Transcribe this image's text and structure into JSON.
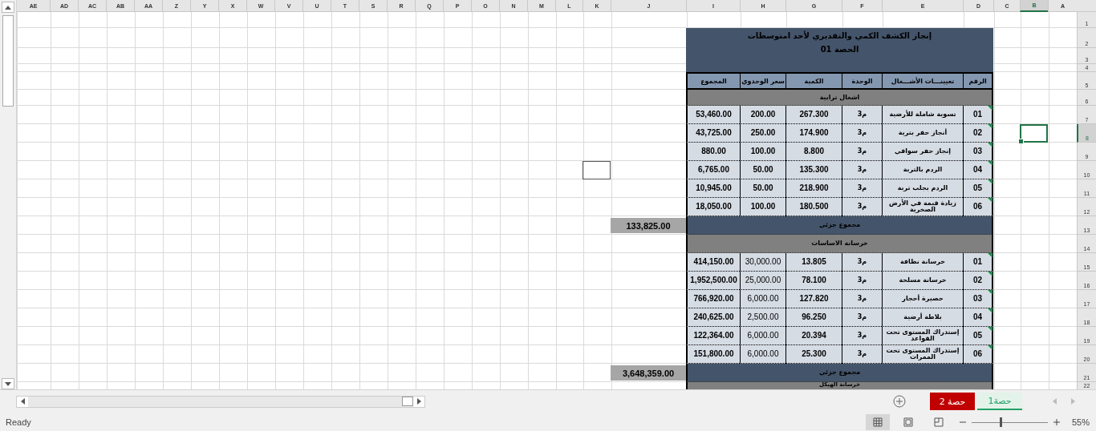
{
  "columns": [
    {
      "label": "A",
      "selected": false
    },
    {
      "label": "B",
      "selected": true
    },
    {
      "label": "C",
      "selected": false
    },
    {
      "label": "D",
      "selected": false
    },
    {
      "label": "E",
      "selected": false
    },
    {
      "label": "F",
      "selected": false
    },
    {
      "label": "G",
      "selected": false
    },
    {
      "label": "H",
      "selected": false
    },
    {
      "label": "I",
      "selected": false
    },
    {
      "label": "J",
      "selected": false
    },
    {
      "label": "K",
      "selected": false
    },
    {
      "label": "L",
      "selected": false
    },
    {
      "label": "M",
      "selected": false
    },
    {
      "label": "N",
      "selected": false
    },
    {
      "label": "O",
      "selected": false
    },
    {
      "label": "P",
      "selected": false
    },
    {
      "label": "Q",
      "selected": false
    },
    {
      "label": "R",
      "selected": false
    },
    {
      "label": "S",
      "selected": false
    },
    {
      "label": "T",
      "selected": false
    },
    {
      "label": "U",
      "selected": false
    },
    {
      "label": "V",
      "selected": false
    },
    {
      "label": "W",
      "selected": false
    },
    {
      "label": "X",
      "selected": false
    },
    {
      "label": "Y",
      "selected": false
    },
    {
      "label": "Z",
      "selected": false
    },
    {
      "label": "AA",
      "selected": false
    },
    {
      "label": "AB",
      "selected": false
    },
    {
      "label": "AC",
      "selected": false
    },
    {
      "label": "AD",
      "selected": false
    },
    {
      "label": "AE",
      "selected": false
    }
  ],
  "rows": [
    {
      "label": "1",
      "selected": false
    },
    {
      "label": "2",
      "selected": false
    },
    {
      "label": "3",
      "selected": false
    },
    {
      "label": "4",
      "selected": false
    },
    {
      "label": "5",
      "selected": false
    },
    {
      "label": "6",
      "selected": false
    },
    {
      "label": "7",
      "selected": false
    },
    {
      "label": "8",
      "selected": true
    },
    {
      "label": "9",
      "selected": false
    },
    {
      "label": "10",
      "selected": false
    },
    {
      "label": "11",
      "selected": false
    },
    {
      "label": "12",
      "selected": false
    },
    {
      "label": "13",
      "selected": false
    },
    {
      "label": "14",
      "selected": false
    },
    {
      "label": "15",
      "selected": false
    },
    {
      "label": "16",
      "selected": false
    },
    {
      "label": "17",
      "selected": false
    },
    {
      "label": "18",
      "selected": false
    },
    {
      "label": "19",
      "selected": false
    },
    {
      "label": "20",
      "selected": false
    },
    {
      "label": "21",
      "selected": false
    },
    {
      "label": "22",
      "selected": false
    }
  ],
  "table": {
    "title": "إنجاز الكشف الكمي والتقديري لأحد امتوسطات",
    "subtitle": "الحصة 01",
    "headers": [
      "الرقم",
      "تعيينـــات الأشـــغال",
      "الوحدة",
      "الكمية",
      "سعر الوحدوي",
      "المجموع"
    ],
    "sections": [
      {
        "name": "اشغال ترابية",
        "bold_prices": true,
        "subtotal_label": "مجموع جزئي",
        "subtotal": "133,825.00",
        "items": [
          {
            "number": "01",
            "description": "تسوية شاملة للأرضية",
            "unit": "م3",
            "quantity": "267.300",
            "unit_price": "200.00",
            "total": "53,460.00"
          },
          {
            "number": "02",
            "description": "أنجاز حفر بترية",
            "unit": "م3",
            "quantity": "174.900",
            "unit_price": "250.00",
            "total": "43,725.00"
          },
          {
            "number": "03",
            "description": "إنجاز حفر سواقي",
            "unit": "م3",
            "quantity": "8.800",
            "unit_price": "100.00",
            "total": "880.00"
          },
          {
            "number": "04",
            "description": "الردم بالتربة",
            "unit": "م3",
            "quantity": "135.300",
            "unit_price": "50.00",
            "total": "6,765.00"
          },
          {
            "number": "05",
            "description": "الردم بجلب تربة",
            "unit": "م3",
            "quantity": "218.900",
            "unit_price": "50.00",
            "total": "10,945.00"
          },
          {
            "number": "06",
            "description": "زيادة قيمة في الأرض الصخرية",
            "unit": "م3",
            "quantity": "180.500",
            "unit_price": "100.00",
            "total": "18,050.00"
          }
        ]
      },
      {
        "name": "خرسانة الاساسات",
        "bold_prices": false,
        "subtotal_label": "مجموع جزئي",
        "subtotal": "3,648,359.00",
        "items": [
          {
            "number": "01",
            "description": "خرسانة نظافة",
            "unit": "م3",
            "quantity": "13.805",
            "unit_price": "30,000.00",
            "total": "414,150.00"
          },
          {
            "number": "02",
            "description": "خرسانة مسلحة",
            "unit": "م3",
            "quantity": "78.100",
            "unit_price": "25,000.00",
            "total": "1,952,500.00"
          },
          {
            "number": "03",
            "description": "حصيرة أحجار",
            "unit": "م3",
            "quantity": "127.820",
            "unit_price": "6,000.00",
            "total": "766,920.00"
          },
          {
            "number": "04",
            "description": "بلاطة أرضية",
            "unit": "م3",
            "quantity": "96.250",
            "unit_price": "2,500.00",
            "total": "240,625.00"
          },
          {
            "number": "05",
            "description": "إستدراك المستوى تحت القواعد",
            "unit": "م3",
            "quantity": "20.394",
            "unit_price": "6,000.00",
            "total": "122,364.00"
          },
          {
            "number": "06",
            "description": "إستدراك المستوى تحت الممرات",
            "unit": "م3",
            "quantity": "25.300",
            "unit_price": "6,000.00",
            "total": "151,800.00"
          }
        ]
      },
      {
        "name": "خرسانة الهيكل"
      }
    ]
  },
  "sheet_tabs": [
    {
      "label": "حصة1",
      "selected": true,
      "color": "#21a366"
    },
    {
      "label": "حصة 2",
      "selected": false,
      "color": "#c00000"
    }
  ],
  "status_bar": {
    "status": "Ready",
    "views": [
      {
        "kind": "normal",
        "selected": true
      },
      {
        "kind": "page-layout",
        "selected": false
      },
      {
        "kind": "page-break",
        "selected": false
      }
    ],
    "zoom": {
      "level": 0.37,
      "label": "55%"
    }
  }
}
